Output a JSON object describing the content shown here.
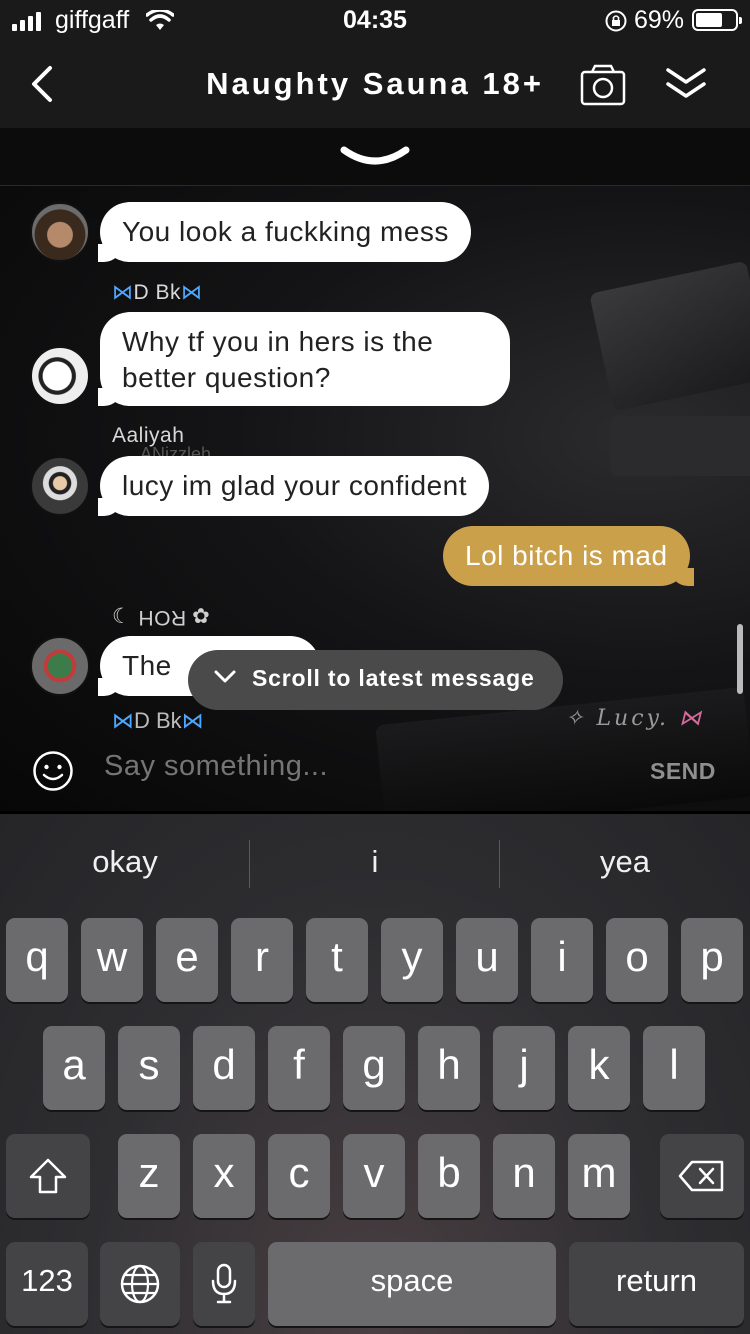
{
  "status_bar": {
    "carrier": "giffgaff",
    "time": "04:35",
    "battery_percent_label": "69%",
    "battery_level": 0.69
  },
  "header": {
    "title": "Naughty Sauna 18+"
  },
  "messages": [
    {
      "sender": "",
      "text": "You look a fuckking mess",
      "direction": "incoming"
    },
    {
      "sender": "D Bk",
      "text_line1": "Why tf you in hers is the",
      "text_line2": "better question?",
      "direction": "incoming"
    },
    {
      "sender": "Aaliyah",
      "text": "lucy im glad your confident",
      "direction": "incoming"
    },
    {
      "sender": "",
      "text": "Lol bitch is mad",
      "direction": "outgoing"
    },
    {
      "sender": "ROH",
      "text": "The",
      "direction": "incoming"
    }
  ],
  "overlay": {
    "scroll_to_latest": "Scroll to latest message",
    "partial_name_bottom": "D Bk",
    "partial_name_middle": "ANizzleh",
    "watermark_name": "Lucy."
  },
  "input": {
    "placeholder": "Say something...",
    "send_label": "SEND"
  },
  "keyboard": {
    "suggestions": [
      "okay",
      "i",
      "yea"
    ],
    "row1": [
      "q",
      "w",
      "e",
      "r",
      "t",
      "y",
      "u",
      "i",
      "o",
      "p"
    ],
    "row2": [
      "a",
      "s",
      "d",
      "f",
      "g",
      "h",
      "j",
      "k",
      "l"
    ],
    "row3": [
      "z",
      "x",
      "c",
      "v",
      "b",
      "n",
      "m"
    ],
    "numbers_label": "123",
    "space_label": "space",
    "return_label": "return"
  },
  "colors": {
    "outgoing_bubble": "#caa04b",
    "incoming_bubble": "#ffffff",
    "header_bg": "#1a1a1a"
  }
}
